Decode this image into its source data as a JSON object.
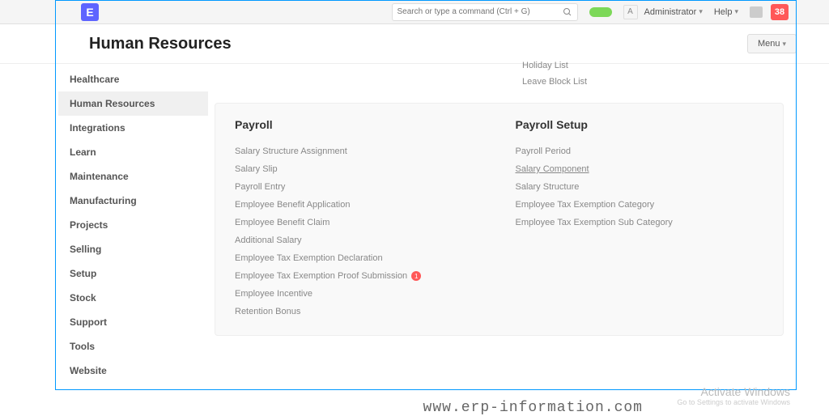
{
  "logo": "E",
  "search": {
    "placeholder": "Search or type a command (Ctrl + G)"
  },
  "avatar_letter": "A",
  "admin_label": "Administrator",
  "help_label": "Help",
  "notif_count": "38",
  "page_title": "Human Resources",
  "menu_btn": "Menu",
  "sidebar": {
    "items": [
      {
        "label": "Healthcare",
        "active": false
      },
      {
        "label": "Human Resources",
        "active": true
      },
      {
        "label": "Integrations",
        "active": false
      },
      {
        "label": "Learn",
        "active": false
      },
      {
        "label": "Maintenance",
        "active": false
      },
      {
        "label": "Manufacturing",
        "active": false
      },
      {
        "label": "Projects",
        "active": false
      },
      {
        "label": "Selling",
        "active": false
      },
      {
        "label": "Setup",
        "active": false
      },
      {
        "label": "Stock",
        "active": false
      },
      {
        "label": "Support",
        "active": false
      },
      {
        "label": "Tools",
        "active": false
      },
      {
        "label": "Website",
        "active": false
      }
    ]
  },
  "top_links": [
    "Holiday List",
    "Leave Block List"
  ],
  "modules": {
    "payroll": {
      "title": "Payroll",
      "items": [
        {
          "label": "Salary Structure Assignment"
        },
        {
          "label": "Salary Slip"
        },
        {
          "label": "Payroll Entry"
        },
        {
          "label": "Employee Benefit Application"
        },
        {
          "label": "Employee Benefit Claim"
        },
        {
          "label": "Additional Salary"
        },
        {
          "label": "Employee Tax Exemption Declaration"
        },
        {
          "label": "Employee Tax Exemption Proof Submission",
          "badge": "1"
        },
        {
          "label": "Employee Incentive"
        },
        {
          "label": "Retention Bonus"
        }
      ]
    },
    "payroll_setup": {
      "title": "Payroll Setup",
      "items": [
        {
          "label": "Payroll Period"
        },
        {
          "label": "Salary Component",
          "hover": true
        },
        {
          "label": "Salary Structure"
        },
        {
          "label": "Employee Tax Exemption Category"
        },
        {
          "label": "Employee Tax Exemption Sub Category"
        }
      ]
    }
  },
  "watermark": {
    "line1": "Activate Windows",
    "line2": "Go to Settings to activate Windows",
    "url": "www.erp-information.com"
  }
}
